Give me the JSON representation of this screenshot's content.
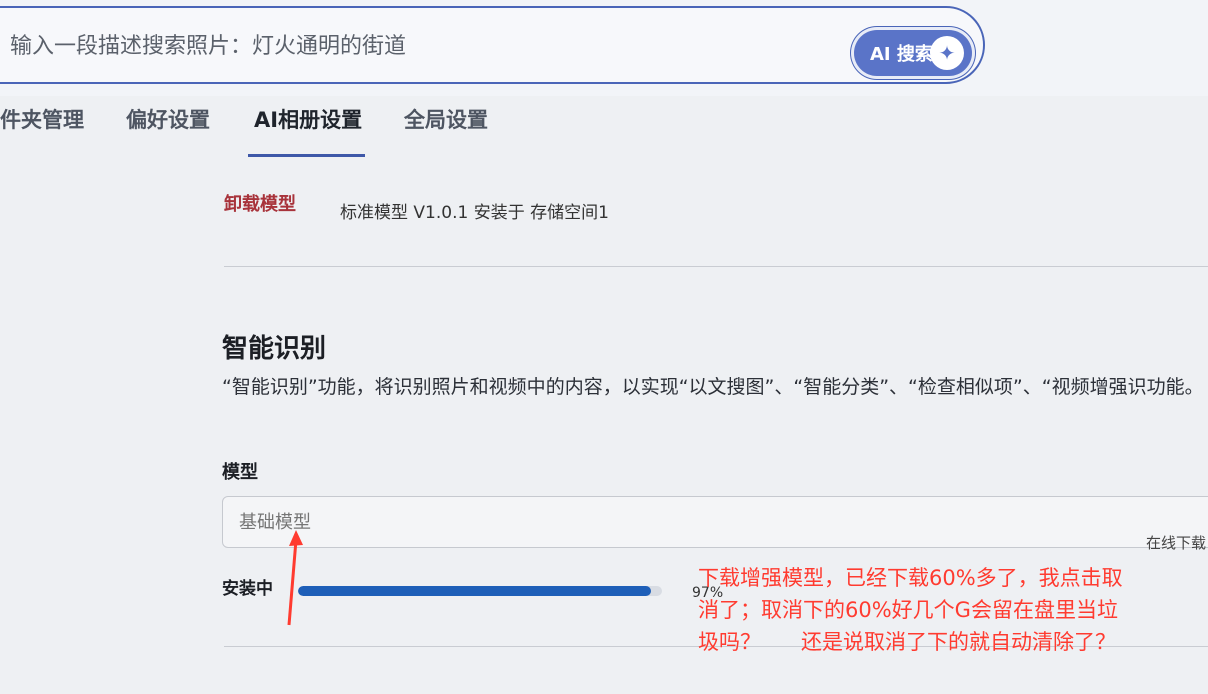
{
  "search": {
    "placeholder": "输入一段描述搜索照片：灯火通明的街道",
    "button_label": "AI 搜索",
    "button_icon": "sparkle-icon"
  },
  "tabs": [
    {
      "label": "件夹管理",
      "active": false
    },
    {
      "label": "偏好设置",
      "active": false
    },
    {
      "label": "AI相册设置",
      "active": true
    },
    {
      "label": "全局设置",
      "active": false
    }
  ],
  "installed_model": {
    "uninstall_label": "卸载模型",
    "info": "标准模型 V1.0.1 安装于 存储空间1"
  },
  "section": {
    "title": "智能识别",
    "description": "“智能识别”功能，将识别照片和视频中的内容，以实现“以文搜图”、“智能分类”、“检查相似项”、“视频增强识功能。",
    "model_label": "模型",
    "model_value": "基础模型",
    "online_download": "在线下载",
    "installing_label": "安装中",
    "progress_percent": 97,
    "progress_text": "97%"
  },
  "annotation": {
    "text": "下载增强模型，已经下载60%多了，我点击取消了；取消下的60%好几个G会留在盘里当垃圾吗？      还是说取消了下的就自动清除了？",
    "color": "#ff3b30"
  },
  "colors": {
    "accent": "#3e58a8",
    "danger": "#a8333b",
    "progress": "#1e5fb8"
  }
}
